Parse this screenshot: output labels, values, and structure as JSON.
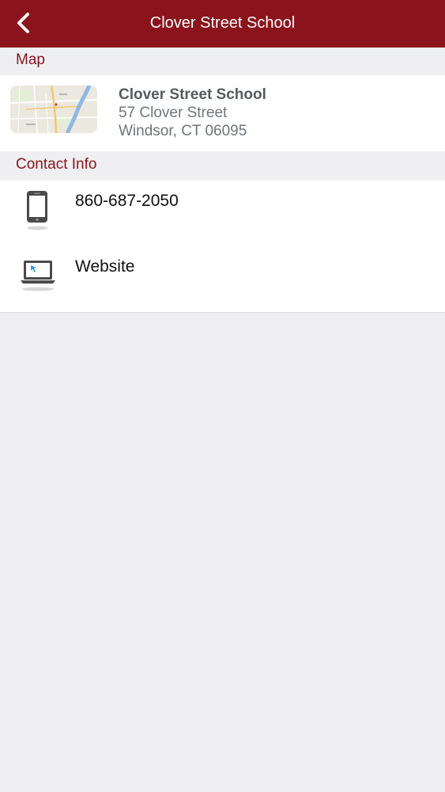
{
  "nav": {
    "title": "Clover Street School",
    "back_icon": "chevron-left-icon"
  },
  "colors": {
    "brand": "#8b141c",
    "background": "#efeff1",
    "section_text": "#8b141c"
  },
  "map_section": {
    "header": "Map",
    "name": "Clover Street School",
    "address_line1": "57 Clover Street",
    "address_line2": "Windsor, CT 06095"
  },
  "contact_section": {
    "header": "Contact Info",
    "items": [
      {
        "label": "860-687-2050",
        "icon": "mobile-phone-icon"
      },
      {
        "label": "Website",
        "icon": "laptop-icon"
      }
    ]
  }
}
